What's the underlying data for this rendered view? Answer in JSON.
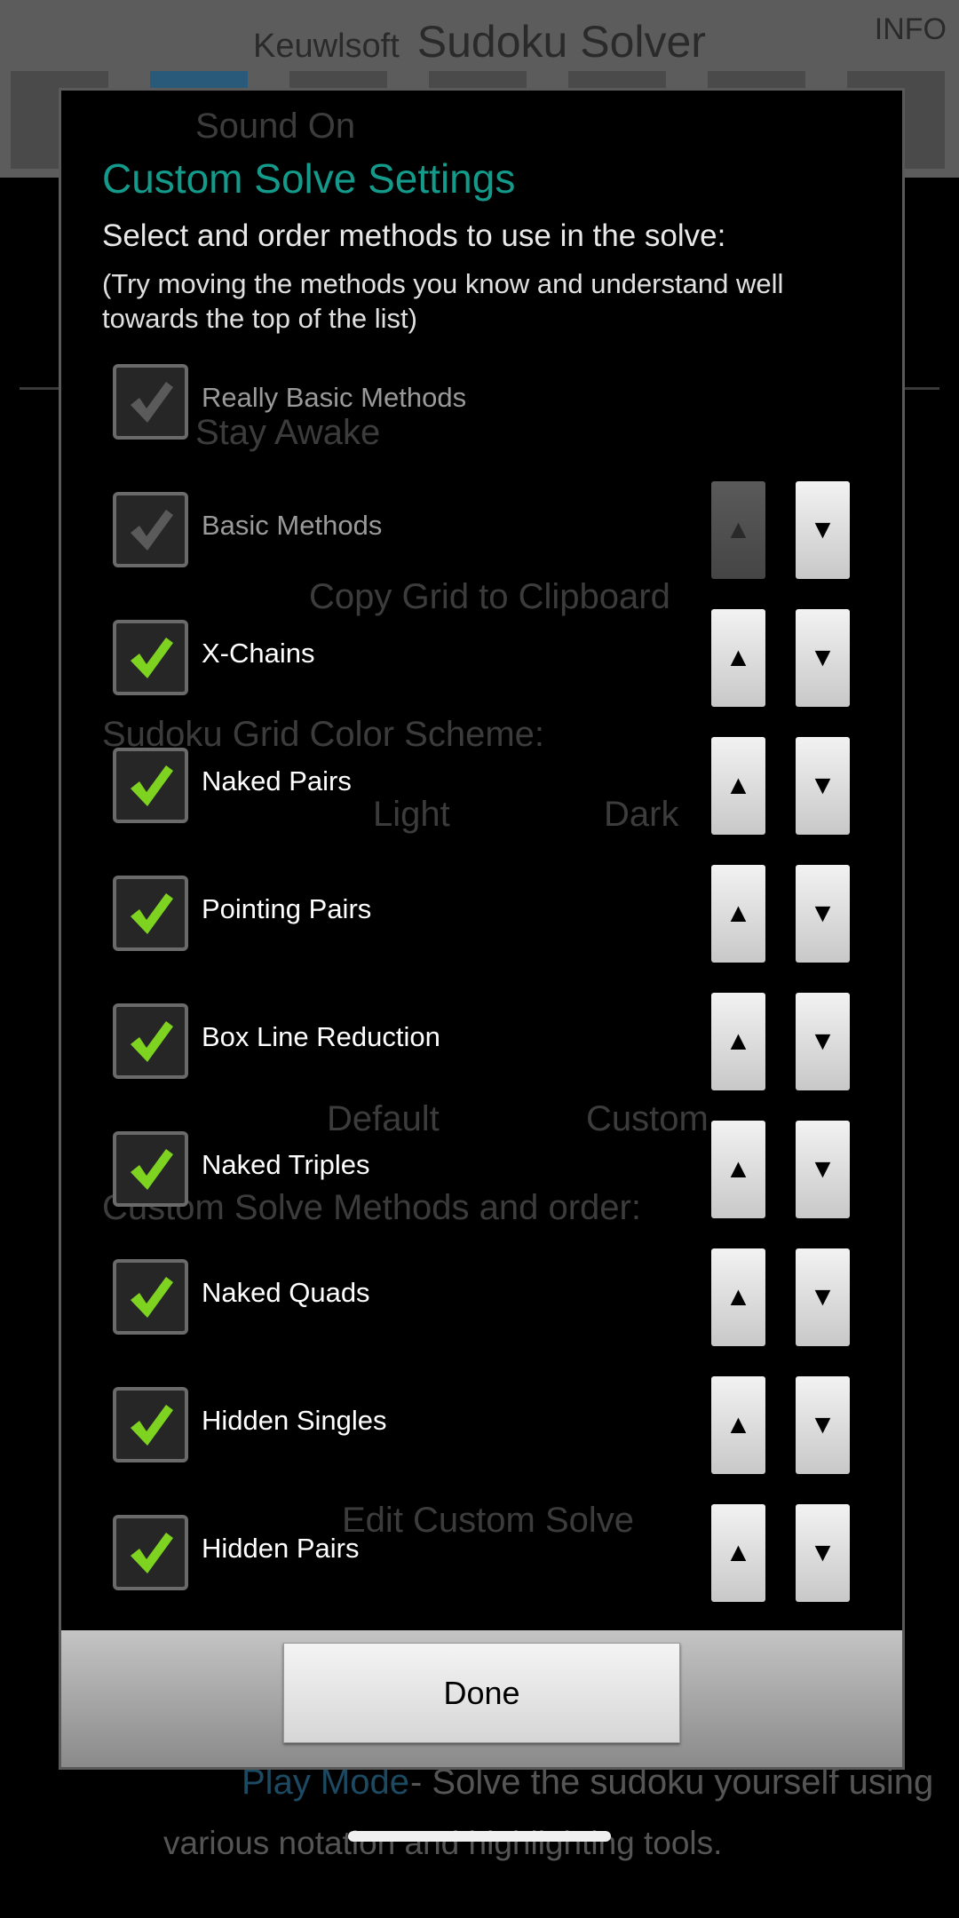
{
  "background": {
    "brand_small": "Keuwlsoft",
    "app_title": "Sudoku Solver",
    "info_label": "INFO",
    "sound_on": "Sound On",
    "stay_awake": "Stay Awake",
    "copy_grid": "Copy Grid to Clipboard",
    "color_scheme": "Sudoku Grid Color Scheme:",
    "light": "Light",
    "dark": "Dark",
    "default": "Default",
    "custom": "Custom",
    "custom_methods": "Custom Solve Methods and order:",
    "edit_custom": "Edit Custom Solve",
    "play_mode": "Play Mode",
    "play_mode_desc": "- Solve the sudoku yourself using",
    "play_mode_desc2": "various notation and highlighting tools."
  },
  "dialog": {
    "title": "Custom Solve Settings",
    "subtitle": "Select and order methods to use in the solve:",
    "hint": "(Try moving the methods you know and understand well towards the top of the list)",
    "methods": [
      {
        "label": "Really Basic Methods",
        "checked": true,
        "enabled": false,
        "buttons": false
      },
      {
        "label": "Basic Methods",
        "checked": true,
        "enabled": false,
        "buttons": true,
        "up_enabled": false
      },
      {
        "label": "X-Chains",
        "checked": true,
        "enabled": true,
        "buttons": true,
        "up_enabled": true
      },
      {
        "label": "Naked Pairs",
        "checked": true,
        "enabled": true,
        "buttons": true,
        "up_enabled": true
      },
      {
        "label": "Pointing Pairs",
        "checked": true,
        "enabled": true,
        "buttons": true,
        "up_enabled": true
      },
      {
        "label": "Box Line Reduction",
        "checked": true,
        "enabled": true,
        "buttons": true,
        "up_enabled": true
      },
      {
        "label": "Naked Triples",
        "checked": true,
        "enabled": true,
        "buttons": true,
        "up_enabled": true
      },
      {
        "label": "Naked Quads",
        "checked": true,
        "enabled": true,
        "buttons": true,
        "up_enabled": true
      },
      {
        "label": "Hidden Singles",
        "checked": true,
        "enabled": true,
        "buttons": true,
        "up_enabled": true
      },
      {
        "label": "Hidden Pairs",
        "checked": true,
        "enabled": true,
        "buttons": true,
        "up_enabled": true
      }
    ],
    "up_glyph": "▲",
    "down_glyph": "▼",
    "done_label": "Done"
  },
  "colors": {
    "accent": "#139a8a",
    "check_enabled": "#7ed321",
    "check_disabled": "#5a5a5a"
  }
}
